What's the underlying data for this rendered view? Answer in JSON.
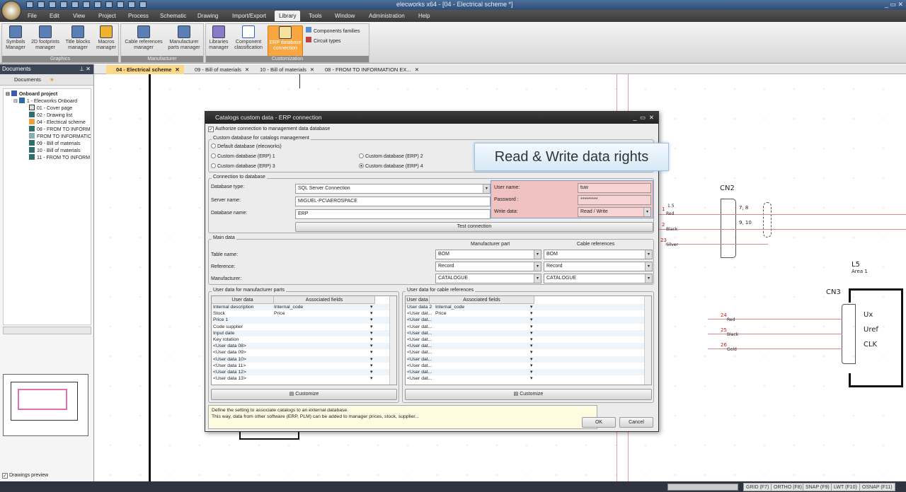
{
  "window": {
    "title": "elecworks x64 - [04 - Electrical scheme *]"
  },
  "menu": [
    "File",
    "Edit",
    "View",
    "Project",
    "Process",
    "Schematic",
    "Drawing",
    "Import/Export",
    "Library",
    "Tools",
    "Window",
    "Administration",
    "Help"
  ],
  "ribbon": {
    "groups": [
      {
        "label": "Graphics"
      },
      {
        "label": "Manufacturer"
      },
      {
        "label": "Customization"
      }
    ],
    "buttons": [
      {
        "l1": "Symbols",
        "l2": "Manager"
      },
      {
        "l1": "2D footprints",
        "l2": "manager"
      },
      {
        "l1": "Title blocks",
        "l2": "manager"
      },
      {
        "l1": "Macros",
        "l2": "manager"
      },
      {
        "l1": "Cable references",
        "l2": "manager"
      },
      {
        "l1": "Manufacturer",
        "l2": "parts manager"
      },
      {
        "l1": "Libraries",
        "l2": "manager"
      },
      {
        "l1": "Component",
        "l2": "classification"
      },
      {
        "l1": "ERP database",
        "l2": "connection"
      }
    ],
    "small": [
      "Components families",
      "Circuit types"
    ]
  },
  "tabs": [
    "04 - Electrical scheme",
    "09 - Bill of materials",
    "10 - Bill of materials",
    "08 - FROM TO INFORMATION EX..."
  ],
  "documents": {
    "title": "Documents",
    "toolbar_label": "Documents",
    "tree": [
      "Onboard project",
      "1 - Elecworks Onboard",
      "01 - Cover page",
      "02 - Drawing list",
      "04 - Electrical scheme",
      "08 - FROM TO INFORM",
      "FROM TO INFORMATIC",
      "09 - Bill of materials",
      "10 - Bill of materials",
      "11 - FROM TO INFORM"
    ],
    "preview_label": "Drawings preview"
  },
  "status": [
    "GRID (F7)",
    "ORTHO (F8)",
    "SNAP (F9)",
    "LWT (F10)",
    "OSNAP (F11)"
  ],
  "dialog": {
    "title": "Catalogs custom data - ERP connection",
    "authorize": "Authorize connection to management data database",
    "custom_db_legend": "Custom database for catalogs management",
    "radios": [
      "Default database (elecworks)",
      "Custom database (ERP) 1",
      "Custom database (ERP) 2",
      "Custom database (ERP) 3",
      "Custom database (ERP) 4"
    ],
    "connection_legend": "Connection to database",
    "db_type_label": "Database type:",
    "db_type": "SQL Server Connection",
    "server_label": "Server name:",
    "server": "MIGUEL-PC\\AEROSPACE",
    "dbname_label": "Database name:",
    "dbname": "ERP",
    "user_label": "User name:",
    "user": "tuw",
    "password_label": "Password :",
    "password": "*********",
    "write_label": "Write data:",
    "write": "Read / Write",
    "test_button": "Test connection",
    "main_legend": "Main data",
    "col_mfr": "Manufacturer part",
    "col_cable": "Cable references",
    "table_label": "Table name:",
    "reference_label": "Reference:",
    "manufacturer_label": "Manufacturer:",
    "mfr_vals": [
      "BOM",
      "Record",
      "CATALOGUE"
    ],
    "cable_vals": [
      "BOM",
      "Record",
      "CATALOGUE"
    ],
    "mfr_user_legend": "User data for manufacturer parts",
    "cable_user_legend": "User data for cable references",
    "col_user": "User data",
    "col_assoc": "Associated fields",
    "mfr_rows": [
      [
        "Internal description",
        "Internal_code"
      ],
      [
        "Stock",
        "Price"
      ],
      [
        "Price 1",
        ""
      ],
      [
        "Code supplier",
        ""
      ],
      [
        "Input date",
        ""
      ],
      [
        "Key rotation",
        ""
      ],
      [
        "<User data 08>",
        ""
      ],
      [
        "<User data 09>",
        ""
      ],
      [
        "<User data 10>",
        ""
      ],
      [
        "<User data 11>",
        ""
      ],
      [
        "<User data 12>",
        ""
      ],
      [
        "<User data 13>",
        ""
      ]
    ],
    "cable_rows": [
      [
        "User data 2",
        "Internal_code"
      ],
      [
        "<User dat...",
        "Price"
      ],
      [
        "<User dat...",
        ""
      ],
      [
        "<User dat...",
        ""
      ],
      [
        "<User dat...",
        ""
      ],
      [
        "<User dat...",
        ""
      ],
      [
        "<User dat...",
        ""
      ],
      [
        "<User dat...",
        ""
      ],
      [
        "<User dat...",
        ""
      ],
      [
        "<User dat...",
        ""
      ],
      [
        "<User dat...",
        ""
      ],
      [
        "<User dat...",
        ""
      ]
    ],
    "customize": "Customize",
    "help1": "Define the setting to associate catalogs to an external database.",
    "help2": "This way, data from other software (ERP, PLM) can be added to manager prices, stock, supplier...",
    "ok": "OK",
    "cancel": "Cancel"
  },
  "overlay": "Read & Write data rights",
  "schematic": {
    "cn2": "CN2",
    "cn3": "CN3",
    "l5": "L5",
    "area": "Area 1",
    "ux": "Ux",
    "uref": "Uref",
    "clk": "CLK",
    "w1": "1",
    "w2": "2",
    "w23": "23",
    "w24": "24",
    "w25": "25",
    "w26": "26",
    "red": "Red",
    "black": "Black",
    "silver": "Silver",
    "gold": "Gold",
    "l15": "1.5",
    "p78": "7, 8",
    "p910": "9, 10"
  }
}
